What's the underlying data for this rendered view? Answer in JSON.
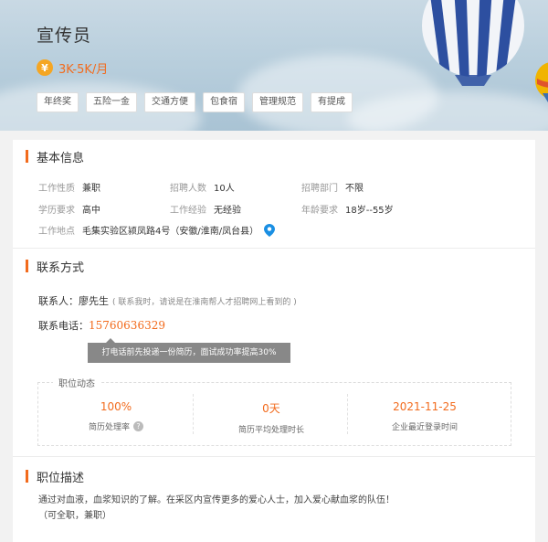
{
  "header": {
    "title": "宣传员",
    "salary_icon": "¥",
    "salary": "3K-5K/月",
    "tags": [
      "年终奖",
      "五险一金",
      "交通方便",
      "包食宿",
      "管理规范",
      "有提成"
    ]
  },
  "basic_info": {
    "heading": "基本信息",
    "fields": {
      "nature_label": "工作性质",
      "nature": "兼职",
      "headcount_label": "招聘人数",
      "headcount": "10人",
      "dept_label": "招聘部门",
      "dept": "不限",
      "edu_label": "学历要求",
      "edu": "高中",
      "exp_label": "工作经验",
      "exp": "无经验",
      "age_label": "年龄要求",
      "age": "18岁--55岁",
      "location_label": "工作地点",
      "location": "毛集实验区颍凤路4号（安徽/淮南/凤台县）"
    }
  },
  "contact": {
    "heading": "联系方式",
    "person_label": "联系人：",
    "person": "廖先生",
    "note": "( 联系我时，请说是在淮南帮人才招聘网上看到的 )",
    "phone_label": "联系电话：",
    "phone": "15760636329",
    "tooltip": "打电话前先投递一份简历，面试成功率提高30%"
  },
  "dynamics": {
    "title": "职位动态",
    "stats": [
      {
        "value": "100%",
        "label": "简历处理率"
      },
      {
        "value": "0天",
        "label": "简历平均处理时长"
      },
      {
        "value": "2021-11-25",
        "label": "企业最近登录时间"
      }
    ],
    "help_icon": "?"
  },
  "description": {
    "heading": "职位描述",
    "line1": "通过对血液，血浆知识的了解。在采区内宣传更多的爱心人士，加入爱心献血浆的队伍！",
    "line2": "（可全职，兼职）"
  },
  "colors": {
    "accent": "#f26b1d",
    "salary_icon_bg": "#f5a623",
    "location_icon": "#1a8fe3"
  }
}
